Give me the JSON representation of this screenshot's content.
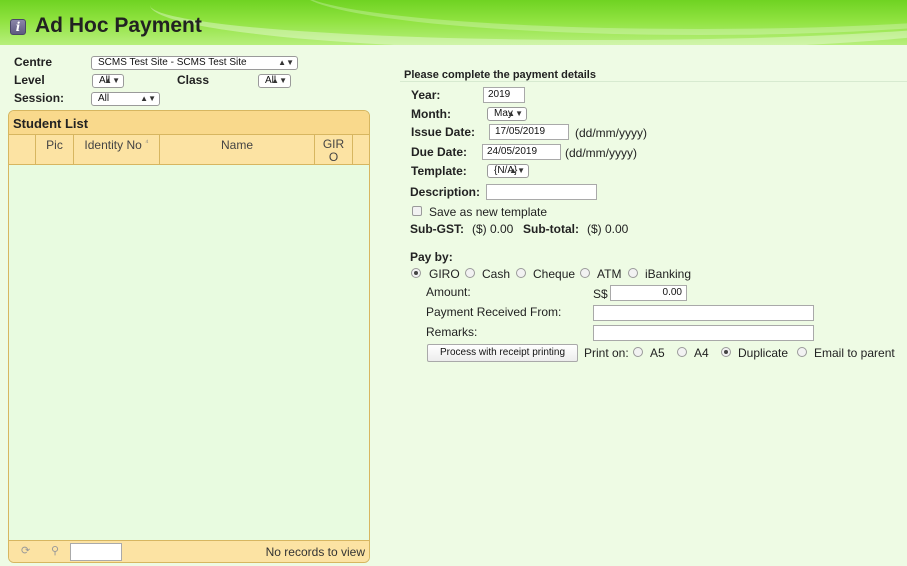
{
  "header": {
    "title": "Ad Hoc Payment"
  },
  "filters": {
    "centre_label": "Centre",
    "centre_value": "SCMS Test Site - SCMS Test Site",
    "level_label": "Level",
    "level_value": "All",
    "class_label": "Class",
    "class_value": "All",
    "session_label": "Session:",
    "session_value": "All"
  },
  "student_list": {
    "title": "Student List",
    "columns": [
      "Pic",
      "Identity No",
      "Name",
      "GIR",
      "O"
    ],
    "sort_indicator": "⁴",
    "rows": [],
    "footer_text": "No records to view"
  },
  "payment": {
    "heading": "Please complete the payment details",
    "year_label": "Year:",
    "year_value": "2019",
    "month_label": "Month:",
    "month_value": "May",
    "issue_date_label": "Issue Date:",
    "issue_date_value": "17/05/2019",
    "date_format": "(dd/mm/yyyy)",
    "due_date_label": "Due Date:",
    "due_date_value": "24/05/2019",
    "template_label": "Template:",
    "template_value": "{N/A}",
    "description_label": "Description:",
    "description_value": "",
    "save_template_label": "Save as new template",
    "sub_gst_label": "Sub-GST:",
    "sub_gst_value": "($) 0.00",
    "sub_total_label": "Sub-total:",
    "sub_total_value": "($) 0.00",
    "pay_by_label": "Pay by:",
    "pay_methods": [
      "GIRO",
      "Cash",
      "Cheque",
      "ATM",
      "iBanking"
    ],
    "selected_pay_method": "GIRO",
    "amount_label": "Amount:",
    "currency": "S$",
    "amount_value": "0.00",
    "received_from_label": "Payment Received From:",
    "received_from_value": "",
    "remarks_label": "Remarks:",
    "remarks_value": "",
    "process_button": "Process with receipt printing",
    "print_on_label": "Print on:",
    "print_options": [
      "A5",
      "A4",
      "Duplicate",
      "Email to parent"
    ],
    "selected_print_option": "Duplicate"
  },
  "colors": {
    "header_green": "#7ed931",
    "page_background": "#eefbe4",
    "grid_header": "#f9d98c",
    "grid_border": "#d7b660"
  }
}
